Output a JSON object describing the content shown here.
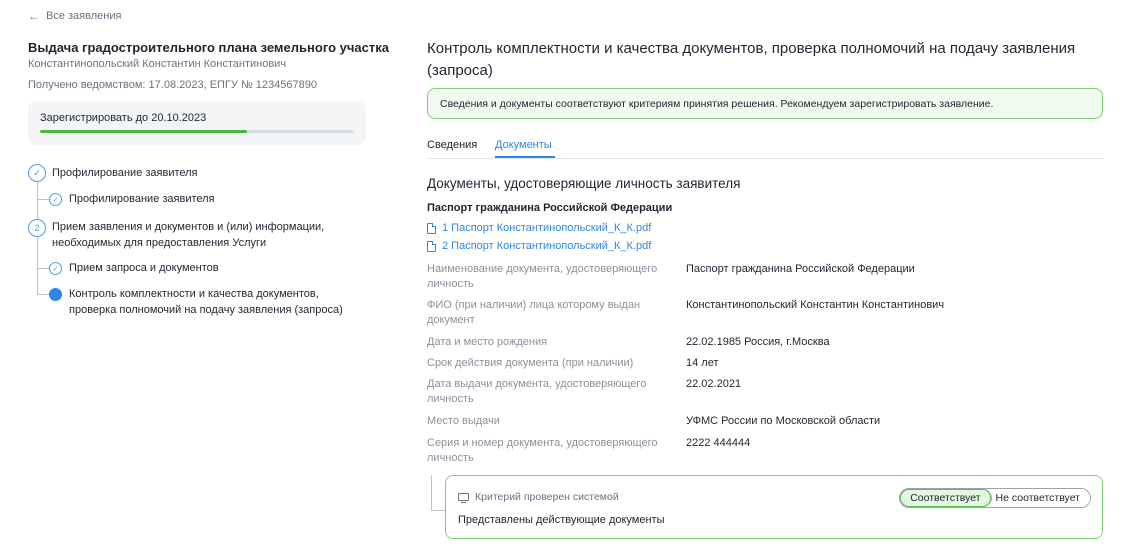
{
  "back_link": "Все заявления",
  "application": {
    "title": "Выдача градостроительного плана земельного участка",
    "applicant": "Константинопольский Константин Константинович",
    "received": "Получено ведомством: 17.08.2023, ЕПГУ № 1234567890",
    "register_deadline": "Зарегистрировать до 20.10.2023",
    "deadline_progress_fraction": 0.66
  },
  "steps": [
    {
      "number": "",
      "state": "done",
      "label": "Профилирование заявителя"
    },
    {
      "state": "done",
      "label": "Профилирование заявителя"
    },
    {
      "number": "2",
      "state": "pending",
      "label_line1": "Прием заявления и документов и (или) информации,",
      "label_line2": "необходимых для предоставления Услуги"
    },
    {
      "state": "done",
      "label": "Прием запроса и документов"
    },
    {
      "state": "current",
      "label_line1": "Контроль комплектности и качества документов,",
      "label_line2": "проверка полномочий на подачу заявления (запроса)"
    }
  ],
  "main": {
    "title": "Контроль комплектности и качества документов, проверка полномочий на подачу заявления (запроса)",
    "alert": "Сведения и документы соответствуют критериям принятия решения. Рекомендуем зарегистрировать заявление.",
    "tabs": [
      {
        "label": "Сведения",
        "active": false
      },
      {
        "label": "Документы",
        "active": true
      }
    ],
    "section_title": "Документы, удостоверяющие личность заявителя",
    "document_name": "Паспорт гражданина Российской Федерации",
    "files": [
      "1 Паспорт Константинопольский_К_К.pdf",
      "2 Паспорт Константинопольский_К_К.pdf"
    ],
    "fields": [
      {
        "label_line1": "Наименование документа, удостоверяющего",
        "label_line2": "личность",
        "value": "Паспорт гражданина Российской Федерации"
      },
      {
        "label_line1": "ФИО (при наличии) лица которому выдан",
        "label_line2": "документ",
        "value": "Константинопольский Константин Константинович"
      },
      {
        "label_line1": "Дата и место рождения",
        "value": "22.02.1985 Россия, г.Москва"
      },
      {
        "label_line1": "Срок действия документа (при наличии)",
        "value": "14 лет"
      },
      {
        "label_line1": "Дата выдачи документа, удостоверяющего",
        "label_line2": "личность",
        "value": "22.02.2021"
      },
      {
        "label_line1": "Место выдачи",
        "value": "УФМС России по Московской области"
      },
      {
        "label_line1": "Серия и номер документа, удостоверяющего",
        "label_line2": "личность",
        "value": "2222 444444"
      }
    ],
    "criterion": {
      "header": "Критерий проверен системой",
      "text": "Представлены действующие документы",
      "match_label": "Соответствует",
      "nomatch_label": "Не соответствует",
      "selected": "match"
    }
  },
  "colors": {
    "accent": "#2f86e3",
    "success": "#46b83a",
    "success_bg": "#f1faef",
    "muted": "#8a919c"
  }
}
